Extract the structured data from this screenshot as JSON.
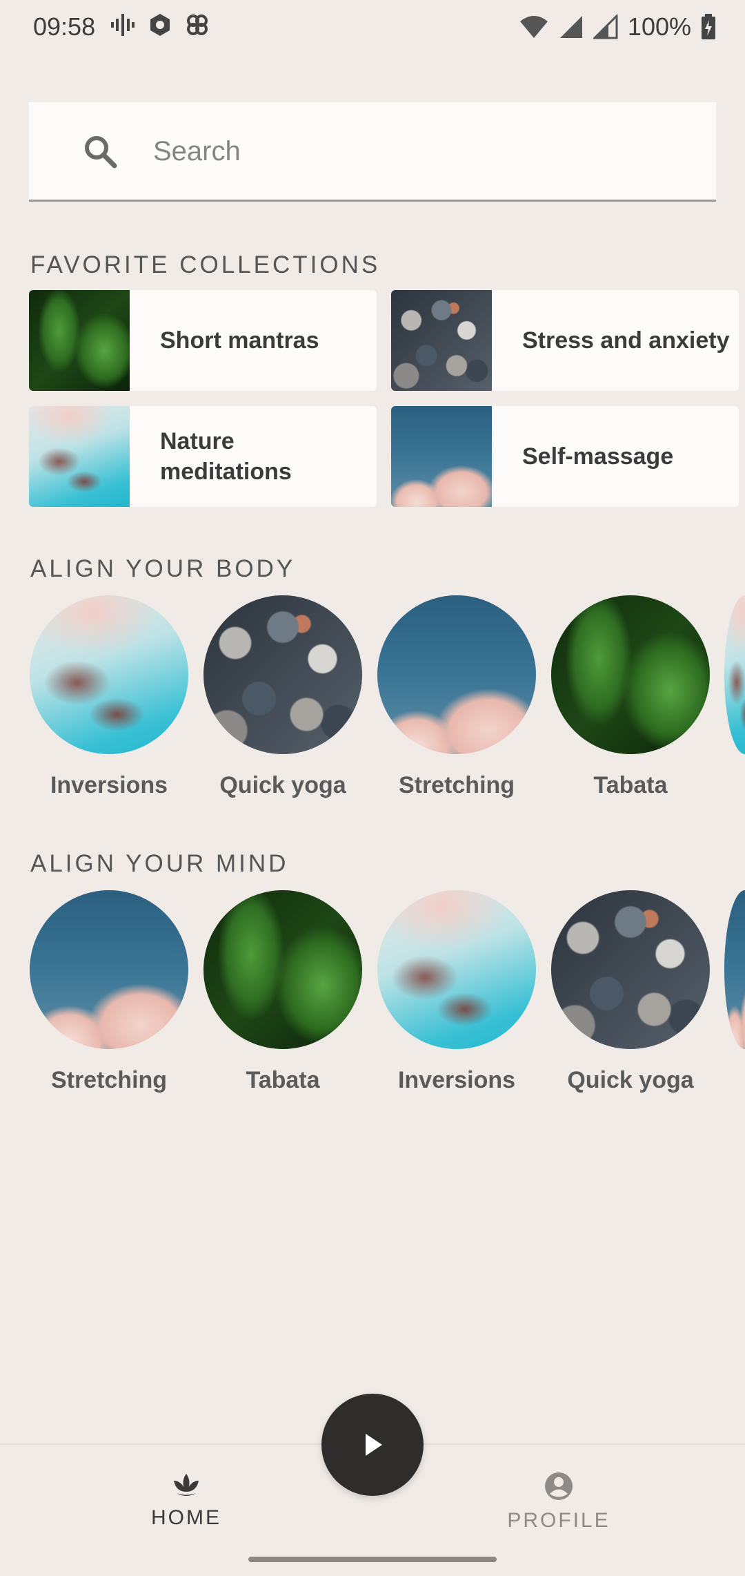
{
  "status_bar": {
    "time": "09:58",
    "battery": "100%",
    "icons_left": [
      "podcast-icon",
      "hexagon-icon",
      "fan-icon"
    ],
    "icons_right": [
      "wifi-icon",
      "cell-signal-icon",
      "cell-signal-icon",
      "battery-charging-icon"
    ]
  },
  "search": {
    "placeholder": "Search"
  },
  "favorites": {
    "title": "FAVORITE COLLECTIONS",
    "items": [
      {
        "label": "Short mantras",
        "image": "leaf"
      },
      {
        "label": "Stress and anxiety",
        "image": "pebble"
      },
      {
        "label": "Nature meditations",
        "image": "coast"
      },
      {
        "label": "Self-massage",
        "image": "cloud"
      }
    ]
  },
  "body": {
    "title": "ALIGN YOUR BODY",
    "items": [
      {
        "label": "Inversions",
        "image": "coast"
      },
      {
        "label": "Quick yoga",
        "image": "pebble"
      },
      {
        "label": "Stretching",
        "image": "cloud"
      },
      {
        "label": "Tabata",
        "image": "leaf"
      }
    ]
  },
  "mind": {
    "title": "ALIGN YOUR MIND",
    "items": [
      {
        "label": "Stretching",
        "image": "cloud"
      },
      {
        "label": "Tabata",
        "image": "leaf"
      },
      {
        "label": "Inversions",
        "image": "coast"
      },
      {
        "label": "Quick yoga",
        "image": "pebble"
      }
    ]
  },
  "nav": {
    "home_label": "HOME",
    "profile_label": "PROFILE",
    "active": "home",
    "active_color": "#3a3a3a",
    "inactive_color": "#8e8a87"
  }
}
